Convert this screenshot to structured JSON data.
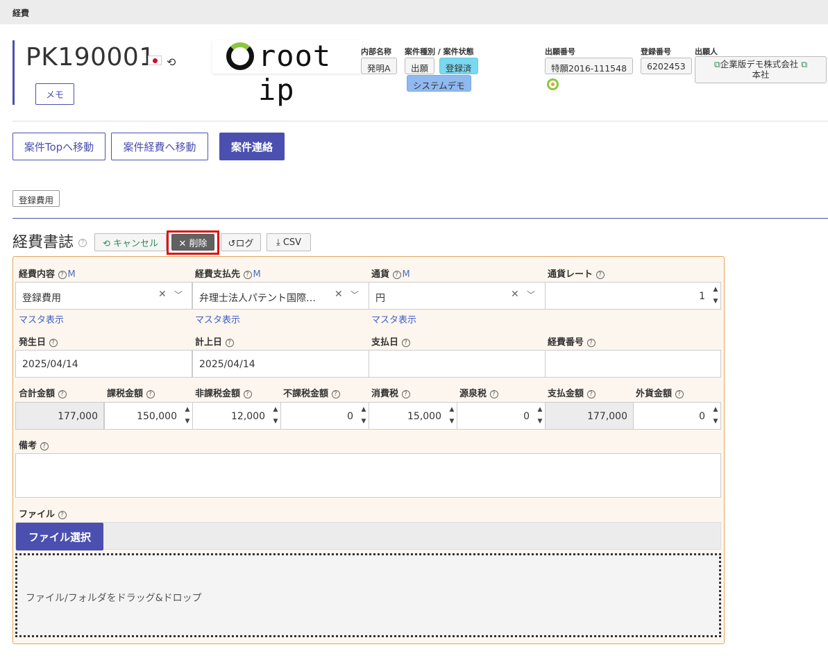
{
  "topbar": {
    "title": "経費"
  },
  "case": {
    "number": "PK190001",
    "memo_label": "メモ",
    "logo_text": "root ip",
    "internal_name_label": "内部名称",
    "internal_name": "発明A",
    "type_status_label": "案件種別 / 案件状態",
    "type": "出願",
    "status": "登録済",
    "system_tag": "システムデモ",
    "app_no_label": "出願番号",
    "app_no": "特願2016-111548",
    "reg_no_label": "登録番号",
    "reg_no": "6202453",
    "applicant_label": "出願人",
    "applicant_line1": "企業版デモ株式会社",
    "applicant_line2": "本社"
  },
  "nav": {
    "case_top": "案件Topへ移動",
    "case_expense": "案件経費へ移動",
    "case_contact": "案件連絡"
  },
  "reg_tab": "登録費用",
  "ledger": {
    "title": "経費書誌",
    "cancel": "キャンセル",
    "delete": "削除",
    "log": "ログ",
    "csv": "CSV"
  },
  "form": {
    "m": "M",
    "master_link": "マスタ表示",
    "content_label": "経費内容",
    "content_value": "登録費用",
    "payee_label": "経費支払先",
    "payee_value": "弁理士法人パテント国際…",
    "currency_label": "通貨",
    "currency_value": "円",
    "rate_label": "通貨レート",
    "rate_value": "1",
    "occur_label": "発生日",
    "occur_value": "2025/04/14",
    "book_label": "計上日",
    "book_value": "2025/04/14",
    "pay_date_label": "支払日",
    "pay_date_value": "",
    "exp_no_label": "経費番号",
    "exp_no_value": "",
    "total_label": "合計金額",
    "total_value": "177,000",
    "taxable_label": "課税金額",
    "taxable_value": "150,000",
    "nontax_label": "非課税金額",
    "nontax_value": "12,000",
    "exempt_label": "不課税金額",
    "exempt_value": "0",
    "ctax_label": "消費税",
    "ctax_value": "15,000",
    "wtax_label": "源泉税",
    "wtax_value": "0",
    "paid_label": "支払金額",
    "paid_value": "177,000",
    "foreign_label": "外貨金額",
    "foreign_value": "0",
    "remarks_label": "備考",
    "remarks_value": "",
    "file_label": "ファイル",
    "file_button": "ファイル選択",
    "drop_text": "ファイル/フォルダをドラッグ&ドロップ"
  }
}
